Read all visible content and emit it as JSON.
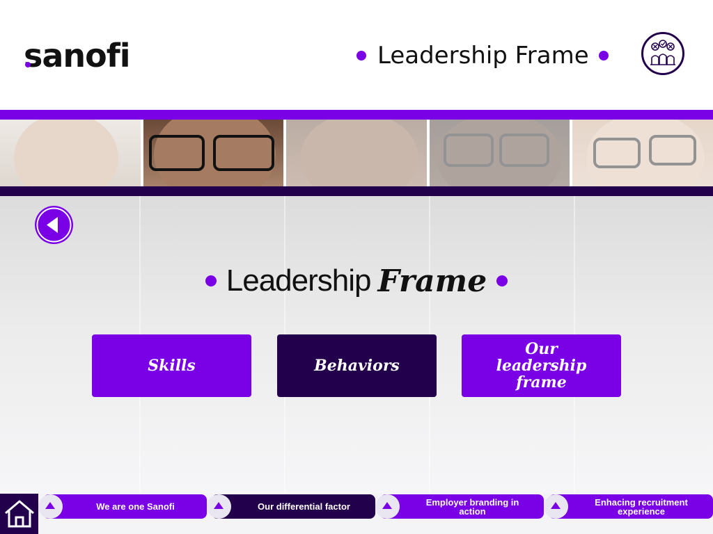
{
  "header": {
    "logo": "sanofi",
    "title": "Leadership Frame"
  },
  "main": {
    "title_regular": "Leadership",
    "title_italic": "Frame",
    "tiles": [
      {
        "label": "Skills"
      },
      {
        "label": "Behaviors"
      },
      {
        "label": "Our leadership frame"
      }
    ]
  },
  "bottom_nav": {
    "items": [
      {
        "label": "We are one Sanofi"
      },
      {
        "label": "Our differential factor"
      },
      {
        "label": "Employer branding in action"
      },
      {
        "label": "Enhacing recruitment experience"
      }
    ]
  },
  "colors": {
    "purple": "#7a00e6",
    "dark_purple": "#23004c"
  },
  "icons": [
    "leadership-badge-icon",
    "back-arrow-icon",
    "home-icon",
    "arrow-up-icon"
  ]
}
